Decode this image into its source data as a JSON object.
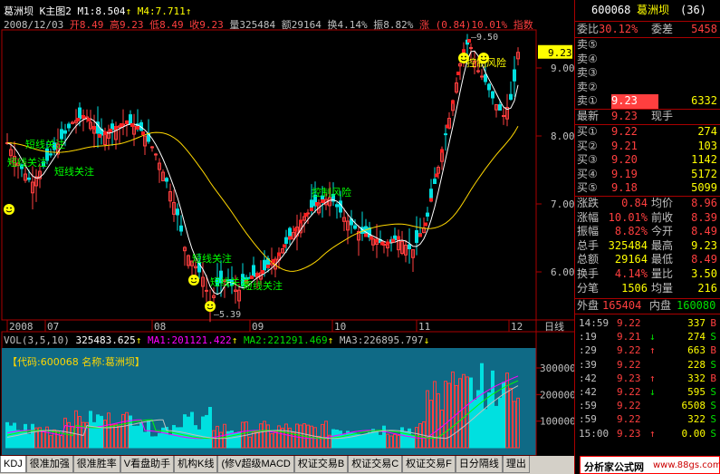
{
  "main_chart": {
    "header_name": "葛洲坝",
    "header_type": "K主图2",
    "ma1_label": "M1:8.504",
    "ma4_label": "M4:7.711",
    "date": "2008/12/03",
    "open": "开8.49",
    "high": "高9.23",
    "low": "低8.49",
    "close": "收9.23",
    "volume": "量325484",
    "amount": "额29164",
    "turnover": "换4.14%",
    "amplitude": "振8.82%",
    "change": "涨 (0.84)10.01%",
    "index_label": "指数",
    "y_ticks": [
      "9.00",
      "8.00",
      "7.00",
      "6.00"
    ],
    "current_price_tag": "9.23",
    "high_marker": "9.50",
    "low_marker": "5.39",
    "x_ticks": [
      "2008",
      "07",
      "08",
      "09",
      "10",
      "11",
      "12"
    ],
    "period": "日线",
    "annotations": {
      "a1": "短线关注",
      "a2": "短线关注",
      "a3": "短线关注",
      "a4": "短线关注",
      "a5": "短线关注",
      "a6": "短线关注",
      "a7": "控制风险",
      "a8": "控制风险"
    }
  },
  "volume_chart": {
    "label": "VOL(3,5,10)",
    "vol": "325483.625",
    "ma1": "MA1:201121.422",
    "ma2": "MA2:221291.469",
    "ma3": "MA3:226895.797",
    "code_info": "【代码:600068 名称:葛洲坝】",
    "y_ticks": [
      "300000",
      "200000",
      "100000"
    ]
  },
  "tabs": [
    "KDJ",
    "很准加强",
    "很准胜率",
    "V看盘助手",
    "机构K线",
    "(修V超级MACD",
    "权证交易B",
    "权证交易C",
    "权证交易F",
    "日分隔线",
    "理出"
  ],
  "quote": {
    "code": "600068",
    "name": "葛洲坝",
    "num": "(36)",
    "wb_label": "委比",
    "wb": "30.12%",
    "wc_label": "委差",
    "wc": "5458",
    "sell": [
      {
        "label": "卖⑤",
        "price": "",
        "vol": ""
      },
      {
        "label": "卖④",
        "price": "",
        "vol": ""
      },
      {
        "label": "卖③",
        "price": "",
        "vol": ""
      },
      {
        "label": "卖②",
        "price": "",
        "vol": ""
      },
      {
        "label": "卖①",
        "price": "9.23",
        "vol": "6332"
      }
    ],
    "latest_label": "最新",
    "latest": "9.23",
    "hand_label": "现手",
    "buy": [
      {
        "label": "买①",
        "price": "9.22",
        "vol": "274"
      },
      {
        "label": "买②",
        "price": "9.21",
        "vol": "103"
      },
      {
        "label": "买③",
        "price": "9.20",
        "vol": "1142"
      },
      {
        "label": "买④",
        "price": "9.19",
        "vol": "5172"
      },
      {
        "label": "买⑤",
        "price": "9.18",
        "vol": "5099"
      }
    ],
    "stats": [
      {
        "l1": "涨跌",
        "v1": "0.84",
        "l2": "均价",
        "v2": "8.96"
      },
      {
        "l1": "涨幅",
        "v1": "10.01%",
        "l2": "前收",
        "v2": "8.39"
      },
      {
        "l1": "振幅",
        "v1": "8.82%",
        "l2": "今开",
        "v2": "8.49"
      },
      {
        "l1": "总手",
        "v1": "325484",
        "l2": "最高",
        "v2": "9.23"
      },
      {
        "l1": "总额",
        "v1": "29164",
        "l2": "最低",
        "v2": "8.49"
      },
      {
        "l1": "换手",
        "v1": "4.14%",
        "l2": "量比",
        "v2": "3.50"
      },
      {
        "l1": "分笔",
        "v1": "1506",
        "l2": "均量",
        "v2": "216"
      }
    ],
    "outer_label": "外盘",
    "outer": "165404",
    "inner_label": "内盘",
    "inner": "160080"
  },
  "ticks": [
    {
      "t": "14:59",
      "p": "9.22",
      "a": "",
      "v": "337",
      "s": "B"
    },
    {
      "t": ":19",
      "p": "9.21",
      "a": "↓",
      "v": "274",
      "s": "S"
    },
    {
      "t": ":29",
      "p": "9.22",
      "a": "↑",
      "v": "663",
      "s": "B"
    },
    {
      "t": ":39",
      "p": "9.22",
      "a": "",
      "v": "228",
      "s": "S"
    },
    {
      "t": ":42",
      "p": "9.23",
      "a": "↑",
      "v": "332",
      "s": "B"
    },
    {
      "t": ":42",
      "p": "9.22",
      "a": "↓",
      "v": "595",
      "s": "S"
    },
    {
      "t": ":59",
      "p": "9.22",
      "a": "",
      "v": "6508",
      "s": "S"
    },
    {
      "t": ":59",
      "p": "9.22",
      "a": "",
      "v": "322",
      "s": "S"
    },
    {
      "t": "15:00",
      "p": "9.23",
      "a": "↑",
      "v": "0.00",
      "s": "S"
    }
  ],
  "footer": {
    "brand": "分析家公式网",
    "url": "www.88gs.com"
  }
}
